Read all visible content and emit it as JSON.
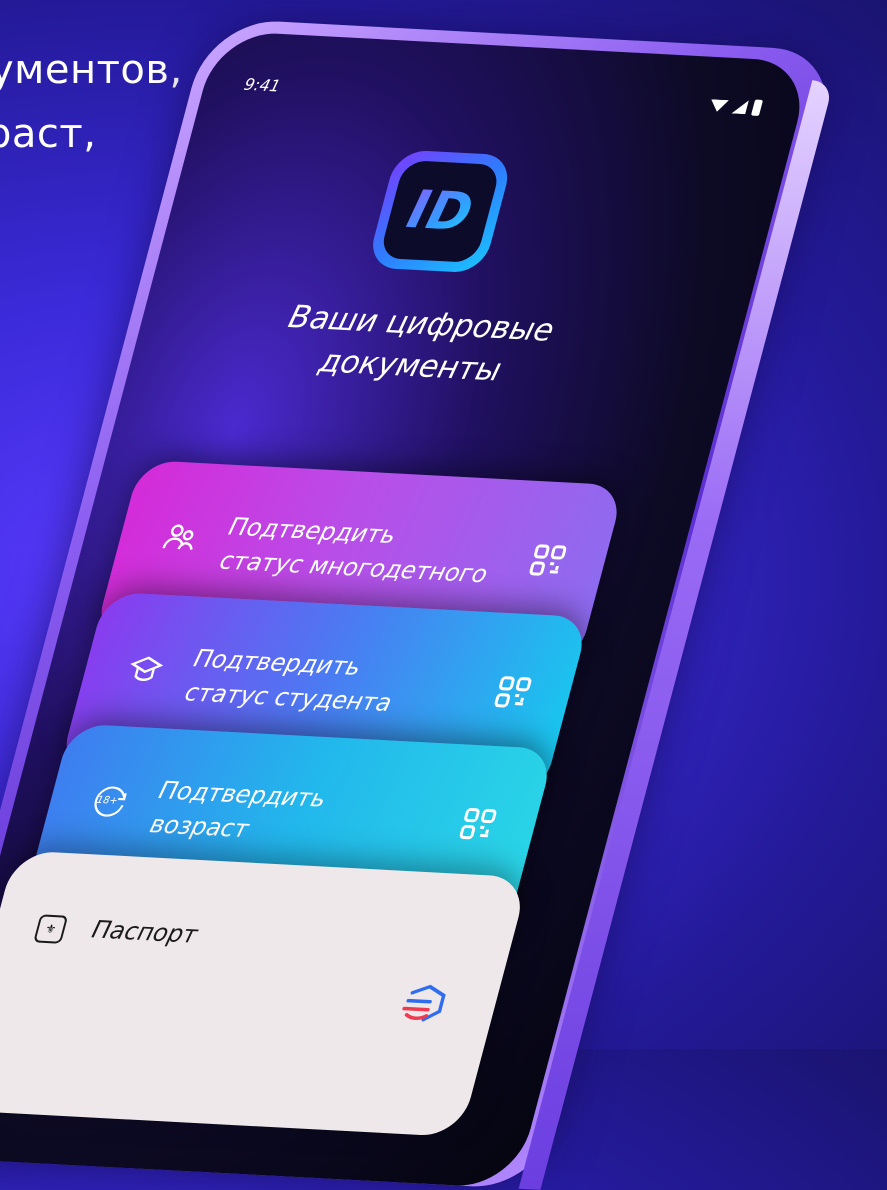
{
  "background_text": {
    "line1": "ументов,",
    "line2": "раст,"
  },
  "phone": {
    "status_bar": {
      "time": "9:41",
      "icons": [
        "wifi-icon",
        "signal-icon",
        "battery-icon"
      ]
    },
    "app_logo_text": "ID",
    "headline": {
      "line1": "Ваши цифровые",
      "line2": "документы"
    },
    "cards": [
      {
        "icon": "family-icon",
        "line1": "Подтвердить",
        "line2": "статус многодетного",
        "action_icon": "qr-icon"
      },
      {
        "icon": "graduation-cap-icon",
        "line1": "Подтвердить",
        "line2": "статус студента",
        "action_icon": "qr-icon"
      },
      {
        "icon": "age-18-icon",
        "icon_text": "18+",
        "line1": "Подтвердить",
        "line2": "возраст",
        "action_icon": "qr-icon"
      }
    ],
    "passport": {
      "icon": "emblem-icon",
      "label": "Паспорт",
      "brand_icon": "gosuslugi-logo-icon"
    }
  },
  "colors": {
    "background": "#3a2ad8",
    "card1": "#c73ce0",
    "card2": "#4a7cf2",
    "card3": "#22b7ec",
    "passport": "#efe8ea"
  }
}
